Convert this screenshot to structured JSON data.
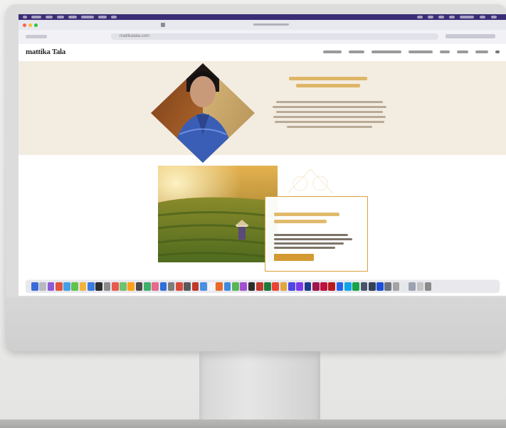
{
  "site": {
    "logo": "mattika Tala"
  },
  "browser": {
    "address": "mattikatala.com"
  },
  "colors": {
    "accent": "#d9a13c",
    "hero_bg": "#f3ece1",
    "menubar": "#3b2c75",
    "card_button": "#d39a33"
  },
  "dock": {
    "icons": [
      "#3a6bd8",
      "#b8b8c2",
      "#8c5bd6",
      "#e0553e",
      "#43a0e8",
      "#62c24b",
      "#f1b33a",
      "#3a7be0",
      "#2d2d2d",
      "#8a8a8a",
      "#e85a4f",
      "#6fc36f",
      "#ff9f1c",
      "#4b4b4b",
      "#3db06a",
      "#e66a8a",
      "#2f6fd8",
      "#7d7d7d",
      "#d84c3a",
      "#5a5a5a",
      "#c0392b",
      "#4a90e2",
      "#f5f5f5",
      "#e86a2a",
      "#3d8be0",
      "#57b657",
      "#a34fd1",
      "#2d2d2d",
      "#c0392b",
      "#1f7a3a",
      "#ea4335",
      "#e2a63b",
      "#4f46e5",
      "#7c3aed",
      "#1e3a8a",
      "#9d174d",
      "#be123c",
      "#b91c1c",
      "#2563eb",
      "#0ea5e9",
      "#16a34a",
      "#475569",
      "#334155",
      "#1d4ed8",
      "#6b7280",
      "#a3a3a3",
      "#e5e7eb",
      "#9ca3af",
      "#c4c4c4",
      "#8b8b8b"
    ]
  }
}
